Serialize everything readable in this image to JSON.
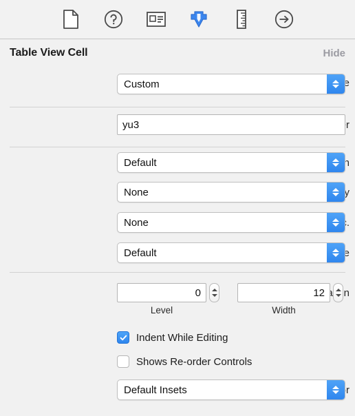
{
  "toolbar": {
    "items": [
      {
        "name": "file-inspector-icon",
        "label": "File inspector",
        "selected": false
      },
      {
        "name": "quick-help-icon",
        "label": "Quick Help inspector",
        "selected": false
      },
      {
        "name": "identity-inspector-icon",
        "label": "Identity inspector",
        "selected": false
      },
      {
        "name": "attributes-inspector-icon",
        "label": "Attributes inspector",
        "selected": true
      },
      {
        "name": "size-inspector-icon",
        "label": "Size inspector",
        "selected": false
      },
      {
        "name": "connections-inspector-icon",
        "label": "Connections inspector",
        "selected": false
      }
    ],
    "accent_color": "#3b86ee"
  },
  "header": {
    "title": "Table View Cell",
    "hide_label": "Hide"
  },
  "fields": {
    "style": {
      "label": "Style",
      "value": "Custom"
    },
    "identifier": {
      "label": "Identifier",
      "value": "yu3",
      "placeholder": ""
    },
    "selection": {
      "label": "Selection",
      "value": "Default"
    },
    "accessory": {
      "label": "Accessory",
      "value": "None"
    },
    "editing_accessory": {
      "label": "Editing Acc.",
      "value": "None"
    },
    "focus_style": {
      "label": "Focus Style",
      "value": "Default"
    },
    "indentation": {
      "label": "Indentation",
      "level": {
        "value": "0",
        "sublabel": "Level"
      },
      "width": {
        "value": "12",
        "sublabel": "Width"
      }
    },
    "separator": {
      "label": "Separator",
      "value": "Default Insets"
    }
  },
  "checkboxes": [
    {
      "label": "Indent While Editing",
      "checked": true
    },
    {
      "label": "Shows Re-order Controls",
      "checked": false
    }
  ],
  "colors": {
    "accent": "#3b86ee",
    "panel_bg": "#f1f1f1",
    "divider": "#d2d2d2"
  }
}
